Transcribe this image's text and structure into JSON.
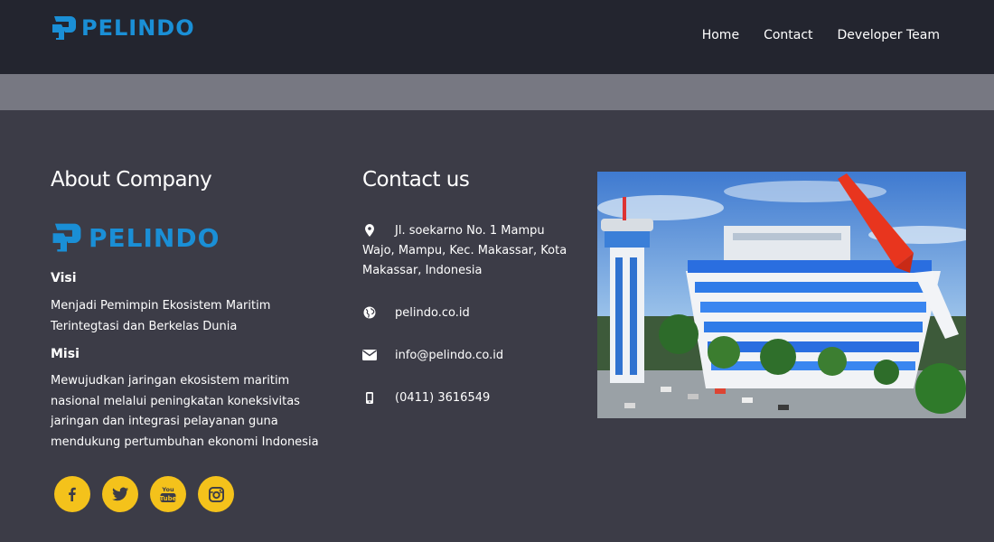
{
  "brand": {
    "name": "PELINDO"
  },
  "nav": {
    "items": [
      "Home",
      "Contact",
      "Developer Team"
    ]
  },
  "about": {
    "title": "About Company",
    "visi_heading": "Visi",
    "visi_text": "Menjadi Pemimpin Ekosistem Maritim Terintegtasi dan Berkelas Dunia",
    "misi_heading": "Misi",
    "misi_text": "Mewujudkan jaringan ekosistem maritim nasional melalui peningkatan koneksivitas jaringan dan integrasi pelayanan guna mendukung pertumbuhan ekonomi Indonesia"
  },
  "contact": {
    "title": "Contact us",
    "address": "Jl. soekarno No. 1 Mampu Wajo, Mampu, Kec. Makassar, Kota Makassar, Indonesia",
    "website": "pelindo.co.id",
    "email": "info@pelindo.co.id",
    "phone": "(0411) 3616549"
  },
  "social": [
    "facebook-icon",
    "twitter-icon",
    "youtube-icon",
    "instagram-icon"
  ],
  "social_labels": {
    "youtube": "You Tube"
  },
  "colors": {
    "navbar": "#23252f",
    "band": "#777882",
    "footer": "#3c3c47",
    "brand_blue": "#1a8fd6",
    "social_yellow": "#f4c21b"
  }
}
